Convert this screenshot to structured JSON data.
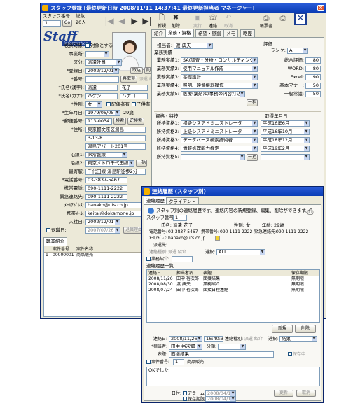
{
  "main": {
    "title": "スタッフ登録 [最終更新日時 2008/11/11 14:37:41 最終更新担当者 マネージャー]",
    "staff_no_label": "スタッフ番号",
    "staff_no": "1",
    "go": "Go",
    "total_label": "総数",
    "total": "20人",
    "toolbar": {
      "new": "新規",
      "delete": "削除",
      "execute": "実行",
      "contact": "連絡",
      "cancel": "取消",
      "print": "帳票書"
    },
    "logo": "Staff",
    "logo_sub": "information",
    "left": {
      "search_target_label": "検索対象:",
      "search_target": "対象とする",
      "office_label": "事業所:",
      "office": "",
      "category_label": "区分:",
      "category": "派遣社員",
      "reg_date_label": "*登録日:",
      "reg_date": "2002/12/01",
      "take_btn": "取込",
      "del_btn": "削除",
      "number_label": "*番号:",
      "number": "",
      "reissue": "再取得",
      "status_flags": "派遣 紹介",
      "name_kanji_label": "*氏名(漢字):",
      "name_kanji_last": "派遣",
      "name_kanji_first": "花子",
      "name_kana_label": "*氏名(カナ):",
      "name_kana_last": "ハケン",
      "name_kana_first": "ハナコ",
      "gender_label": "*性別:",
      "gender": "女",
      "spouse": "配偶者有",
      "child": "子供有",
      "birth_label": "*生年月日:",
      "birth": "1979/06/05",
      "age": "29歳",
      "zip_label": "*郵便番号:",
      "zip": "113-0034",
      "search_btn": "検索",
      "reverse_btn": "逆検索",
      "address_label": "*住所:",
      "address1": "東京都文京区湯島",
      "address2": "3-13-8",
      "address3": "湯島アパート201号",
      "line1_label": "沿線1:",
      "line1": "JR常磐線",
      "line2_label": "沿線2:",
      "line2": "東京メトロ千代田線",
      "line_btn": "一括",
      "station_label": "最寄駅:",
      "station": "千代田線 湯島駅徒歩2分",
      "tel_label": "*電話番号:",
      "tel": "03-3837-5467",
      "mobile_label": "携帯電話:",
      "mobile": "090-1111-2222",
      "emergency_label": "緊急連絡先:",
      "emergency": "090-1111-2222",
      "mail_label": "ﾒｰﾙｱﾄﾞﾚｽ:",
      "mail": "hanako@uts.co.jp",
      "mobile_mail_label": "携帯ﾒｰﾙ:",
      "mobile_mail": "keitai@dokamone.jp",
      "join_label": "入社日:",
      "join": "2002/12/01",
      "retire_label": "退職日:",
      "retire": "2007/07/26",
      "retire_reason": "退職理由",
      "intro_tab": "職業紹介",
      "case_headers": [
        "",
        "案件番号",
        "案件名称"
      ],
      "cases": [
        [
          "1",
          "00000001",
          "商品販売"
        ]
      ]
    },
    "right": {
      "tabs": [
        "紹介",
        "業務・資格",
        "希望・懲罰",
        "メモ",
        "略歴"
      ],
      "staff_label": "担当者:",
      "staff": "渡 典夫",
      "eval_label": "評価",
      "rank_label": "ランク:",
      "rank": "A",
      "exp_title": "業務実績",
      "exps": [
        {
          "label": "業務実績1:",
          "value": "SA(調査・分析・コンサルティング)"
        },
        {
          "label": "業務実績2:",
          "value": "使用マニュアル作成"
        },
        {
          "label": "業務実績3:",
          "value": "基礎設計"
        },
        {
          "label": "業務実績4:",
          "value": "照明、映像機器操作"
        },
        {
          "label": "業務実績5:",
          "value": "医療(薬剤)の事務の内容打込"
        }
      ],
      "exp_btn": "一括",
      "scores": [
        {
          "label": "総合評価:",
          "value": "80"
        },
        {
          "label": "WORD:",
          "value": "80"
        },
        {
          "label": "Excel:",
          "value": "90"
        },
        {
          "label": "基本マナー:",
          "value": "50"
        },
        {
          "label": "一般常識:",
          "value": "50"
        }
      ],
      "qual_title": "資格・特技",
      "acq_title": "取得年月日",
      "quals": [
        {
          "label": "所持資格1:",
          "value": "初級シスアドミニストレータ",
          "date": "平成16年6月"
        },
        {
          "label": "所持資格2:",
          "value": "上級シスアドミニストレータ",
          "date": "平成16年10月"
        },
        {
          "label": "所持資格3:",
          "value": "データベース検索技術者",
          "date": "平成18年12月"
        },
        {
          "label": "所持資格4:",
          "value": "情報処理能力検定",
          "date": "平成19年2月"
        },
        {
          "label": "所持資格5:",
          "value": "",
          "date": ""
        }
      ],
      "qual_btn": "一括"
    }
  },
  "contact": {
    "title": "連絡履歴 (スタッフ別)",
    "tabs": [
      "連絡履歴",
      "クライアント"
    ],
    "desc": "スタッフ別の連絡履歴です。連絡内容の新規登録、編集、削除ができます。",
    "staff_no_label": "スタッフ番号:",
    "staff_no": "1",
    "name_label": "氏名:",
    "name": "派遣 花子",
    "gender_label": "性別:",
    "gender": "女",
    "age_label": "年齢:",
    "age": "29歳",
    "tel_label": "電話番号:",
    "tel": "03-3837-5467",
    "mobile_label": "携帯番号:",
    "mobile": "090-1111-2222",
    "emerg_label": "緊急連絡先:",
    "emerg": "090-1111-2222",
    "mail_label": "ﾒｰﾙｱﾄﾞﾚｽ:",
    "mail": "hanako@uts.co.jp",
    "dispatch_label": "派遣先:",
    "dispatch": "",
    "filter_label": "連絡種別:",
    "filter": "派遣 紹介",
    "select_label": "選択:",
    "select": "ALL",
    "biz_label": "業務紹介:",
    "biz": "",
    "list_title": "連絡履歴一覧",
    "list_headers": [
      "連絡日",
      "担当者名",
      "表題",
      "保存期限"
    ],
    "list_rows": [
      [
        "2008/11/26",
        "田中 裕次郎",
        "面接結果",
        "無期限"
      ],
      [
        "2008/08/30",
        "渡 典夫",
        "業務紹介",
        "無期限"
      ],
      [
        "2008/07/24",
        "田中 裕次郎",
        "面接日程連絡",
        "無期限"
      ]
    ],
    "new_btn": "新規",
    "del_btn": "削除",
    "date_label": "連絡日:",
    "date": "2008/11/26",
    "time": "16:40:37",
    "type_label": "連絡種別:",
    "type": "派遣 紹介",
    "sel2_label": "選択:",
    "sel2": "結果",
    "staff_label": "*担当者:",
    "staff": "田中 裕次郎",
    "class_label": "分類:",
    "class": "",
    "subject_label": "表題:",
    "subject": "面接結果",
    "save_label": "保存中",
    "case_label": "案件番号:",
    "case_no": "1",
    "case_name": "商品販売",
    "memo": "OKでした",
    "alarm_date_label": "日付:",
    "alarm_label": "アラーム",
    "alarm_date": "2008/04/16",
    "save_term_label": "保存期限",
    "save_term": "2008/04/16",
    "update_btn": "更新",
    "cancel_btn": "取消"
  }
}
